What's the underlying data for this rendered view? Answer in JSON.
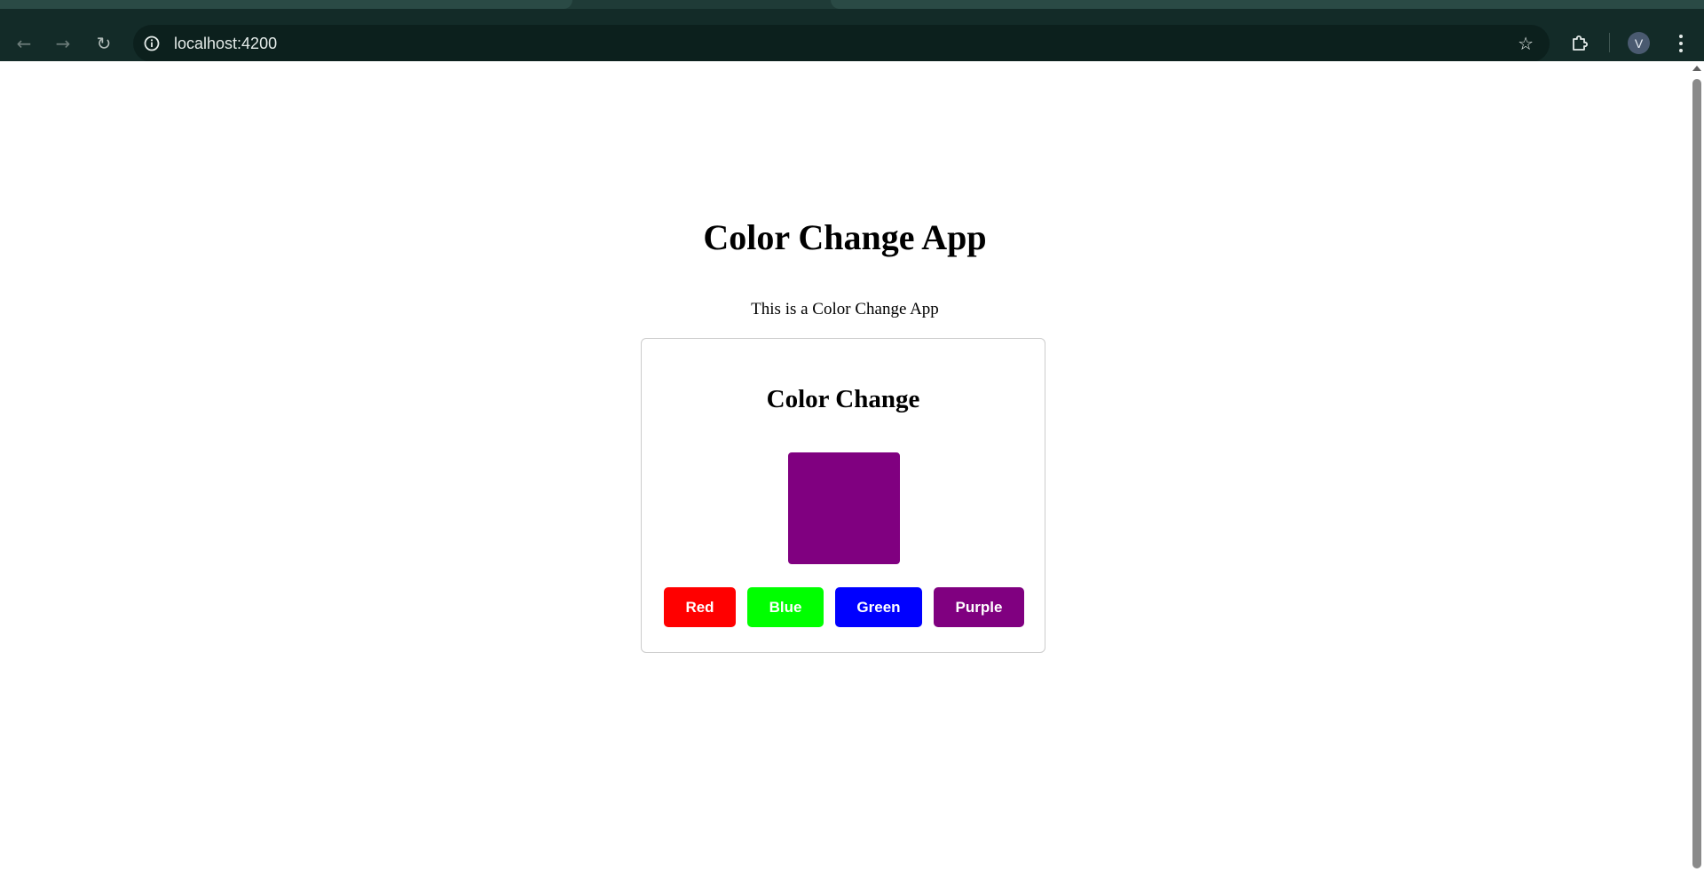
{
  "browser": {
    "url": "localhost:4200",
    "profile_initial": "V",
    "icons": {
      "back": "arrow-left-icon",
      "forward": "arrow-right-icon",
      "reload": "reload-icon",
      "site_info": "info-icon",
      "bookmark": "star-icon",
      "extensions": "puzzle-icon",
      "menu": "kebab-menu-icon"
    }
  },
  "page": {
    "title": "Color Change App",
    "description": "This is a Color Change App"
  },
  "card": {
    "title": "Color Change",
    "current_color": "#800080",
    "buttons": [
      {
        "label": "Red",
        "color": "#ff0000"
      },
      {
        "label": "Blue",
        "color": "#00ff00"
      },
      {
        "label": "Green",
        "color": "#0000ff"
      },
      {
        "label": "Purple",
        "color": "#800080"
      }
    ]
  }
}
